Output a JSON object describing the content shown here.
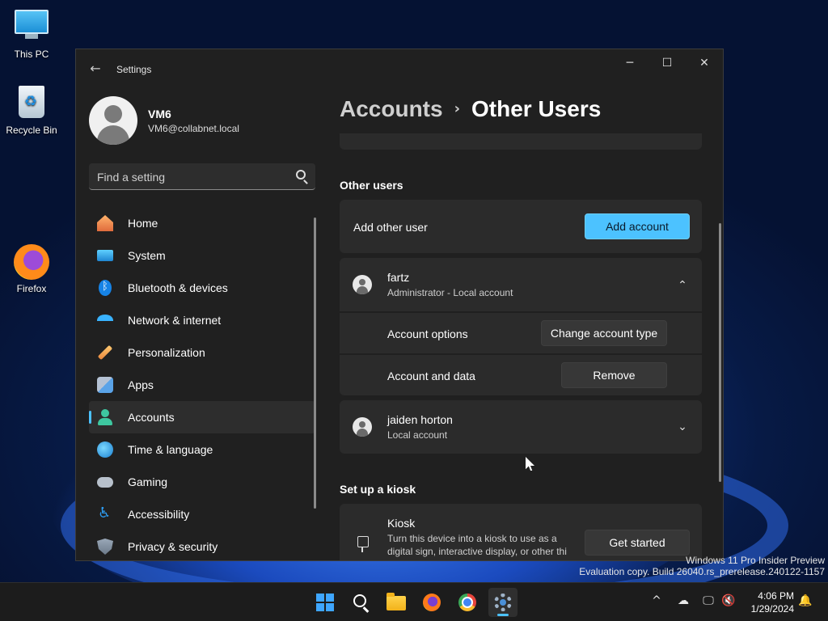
{
  "desktop": {
    "icons": [
      {
        "label": "This PC"
      },
      {
        "label": "Recycle Bin"
      },
      {
        "label": "Firefox"
      }
    ],
    "watermark": {
      "line1": "Windows 11 Pro Insider Preview",
      "line2": "Evaluation copy. Build 26040.rs_prerelease.240122-1157"
    }
  },
  "window": {
    "title": "Settings",
    "controls": {
      "minimize": "─",
      "maximize": "☐",
      "close": "✕"
    },
    "back_glyph": "←"
  },
  "profile": {
    "name": "VM6",
    "email": "VM6@collabnet.local"
  },
  "search": {
    "placeholder": "Find a setting"
  },
  "nav": {
    "items": [
      {
        "label": "Home",
        "icon": "home-icon"
      },
      {
        "label": "System",
        "icon": "system-icon"
      },
      {
        "label": "Bluetooth & devices",
        "icon": "bluetooth-icon"
      },
      {
        "label": "Network & internet",
        "icon": "wifi-icon"
      },
      {
        "label": "Personalization",
        "icon": "brush-icon"
      },
      {
        "label": "Apps",
        "icon": "apps-icon"
      },
      {
        "label": "Accounts",
        "icon": "accounts-icon",
        "selected": true
      },
      {
        "label": "Time & language",
        "icon": "globe-icon"
      },
      {
        "label": "Gaming",
        "icon": "controller-icon"
      },
      {
        "label": "Accessibility",
        "icon": "accessibility-icon"
      },
      {
        "label": "Privacy & security",
        "icon": "shield-icon"
      }
    ]
  },
  "breadcrumb": {
    "parent": "Accounts",
    "separator": "›",
    "current": "Other Users"
  },
  "other_users": {
    "section_title": "Other users",
    "add_label": "Add other user",
    "add_button": "Add account",
    "users": [
      {
        "name": "fartz",
        "subtitle": "Administrator - Local account",
        "expanded": true,
        "options_label": "Account options",
        "options_button": "Change account type",
        "data_label": "Account and data",
        "data_button": "Remove"
      },
      {
        "name": "jaiden horton",
        "subtitle": "Local account",
        "expanded": false
      }
    ]
  },
  "kiosk": {
    "section_title": "Set up a kiosk",
    "title": "Kiosk",
    "description": "Turn this device into a kiosk to use as a digital sign, interactive display, or other thi",
    "button": "Get started"
  },
  "taskbar": {
    "apps": [
      "start",
      "search",
      "file-explorer",
      "firefox",
      "chrome",
      "settings"
    ],
    "active_app": "settings",
    "tray": {
      "chevron": "^"
    },
    "time": "4:06 PM",
    "date": "1/29/2024"
  },
  "colors": {
    "accent": "#4cc2ff",
    "window_bg": "#202020",
    "card_bg": "#2b2b2b",
    "taskbar_bg": "#1c1c1c"
  }
}
